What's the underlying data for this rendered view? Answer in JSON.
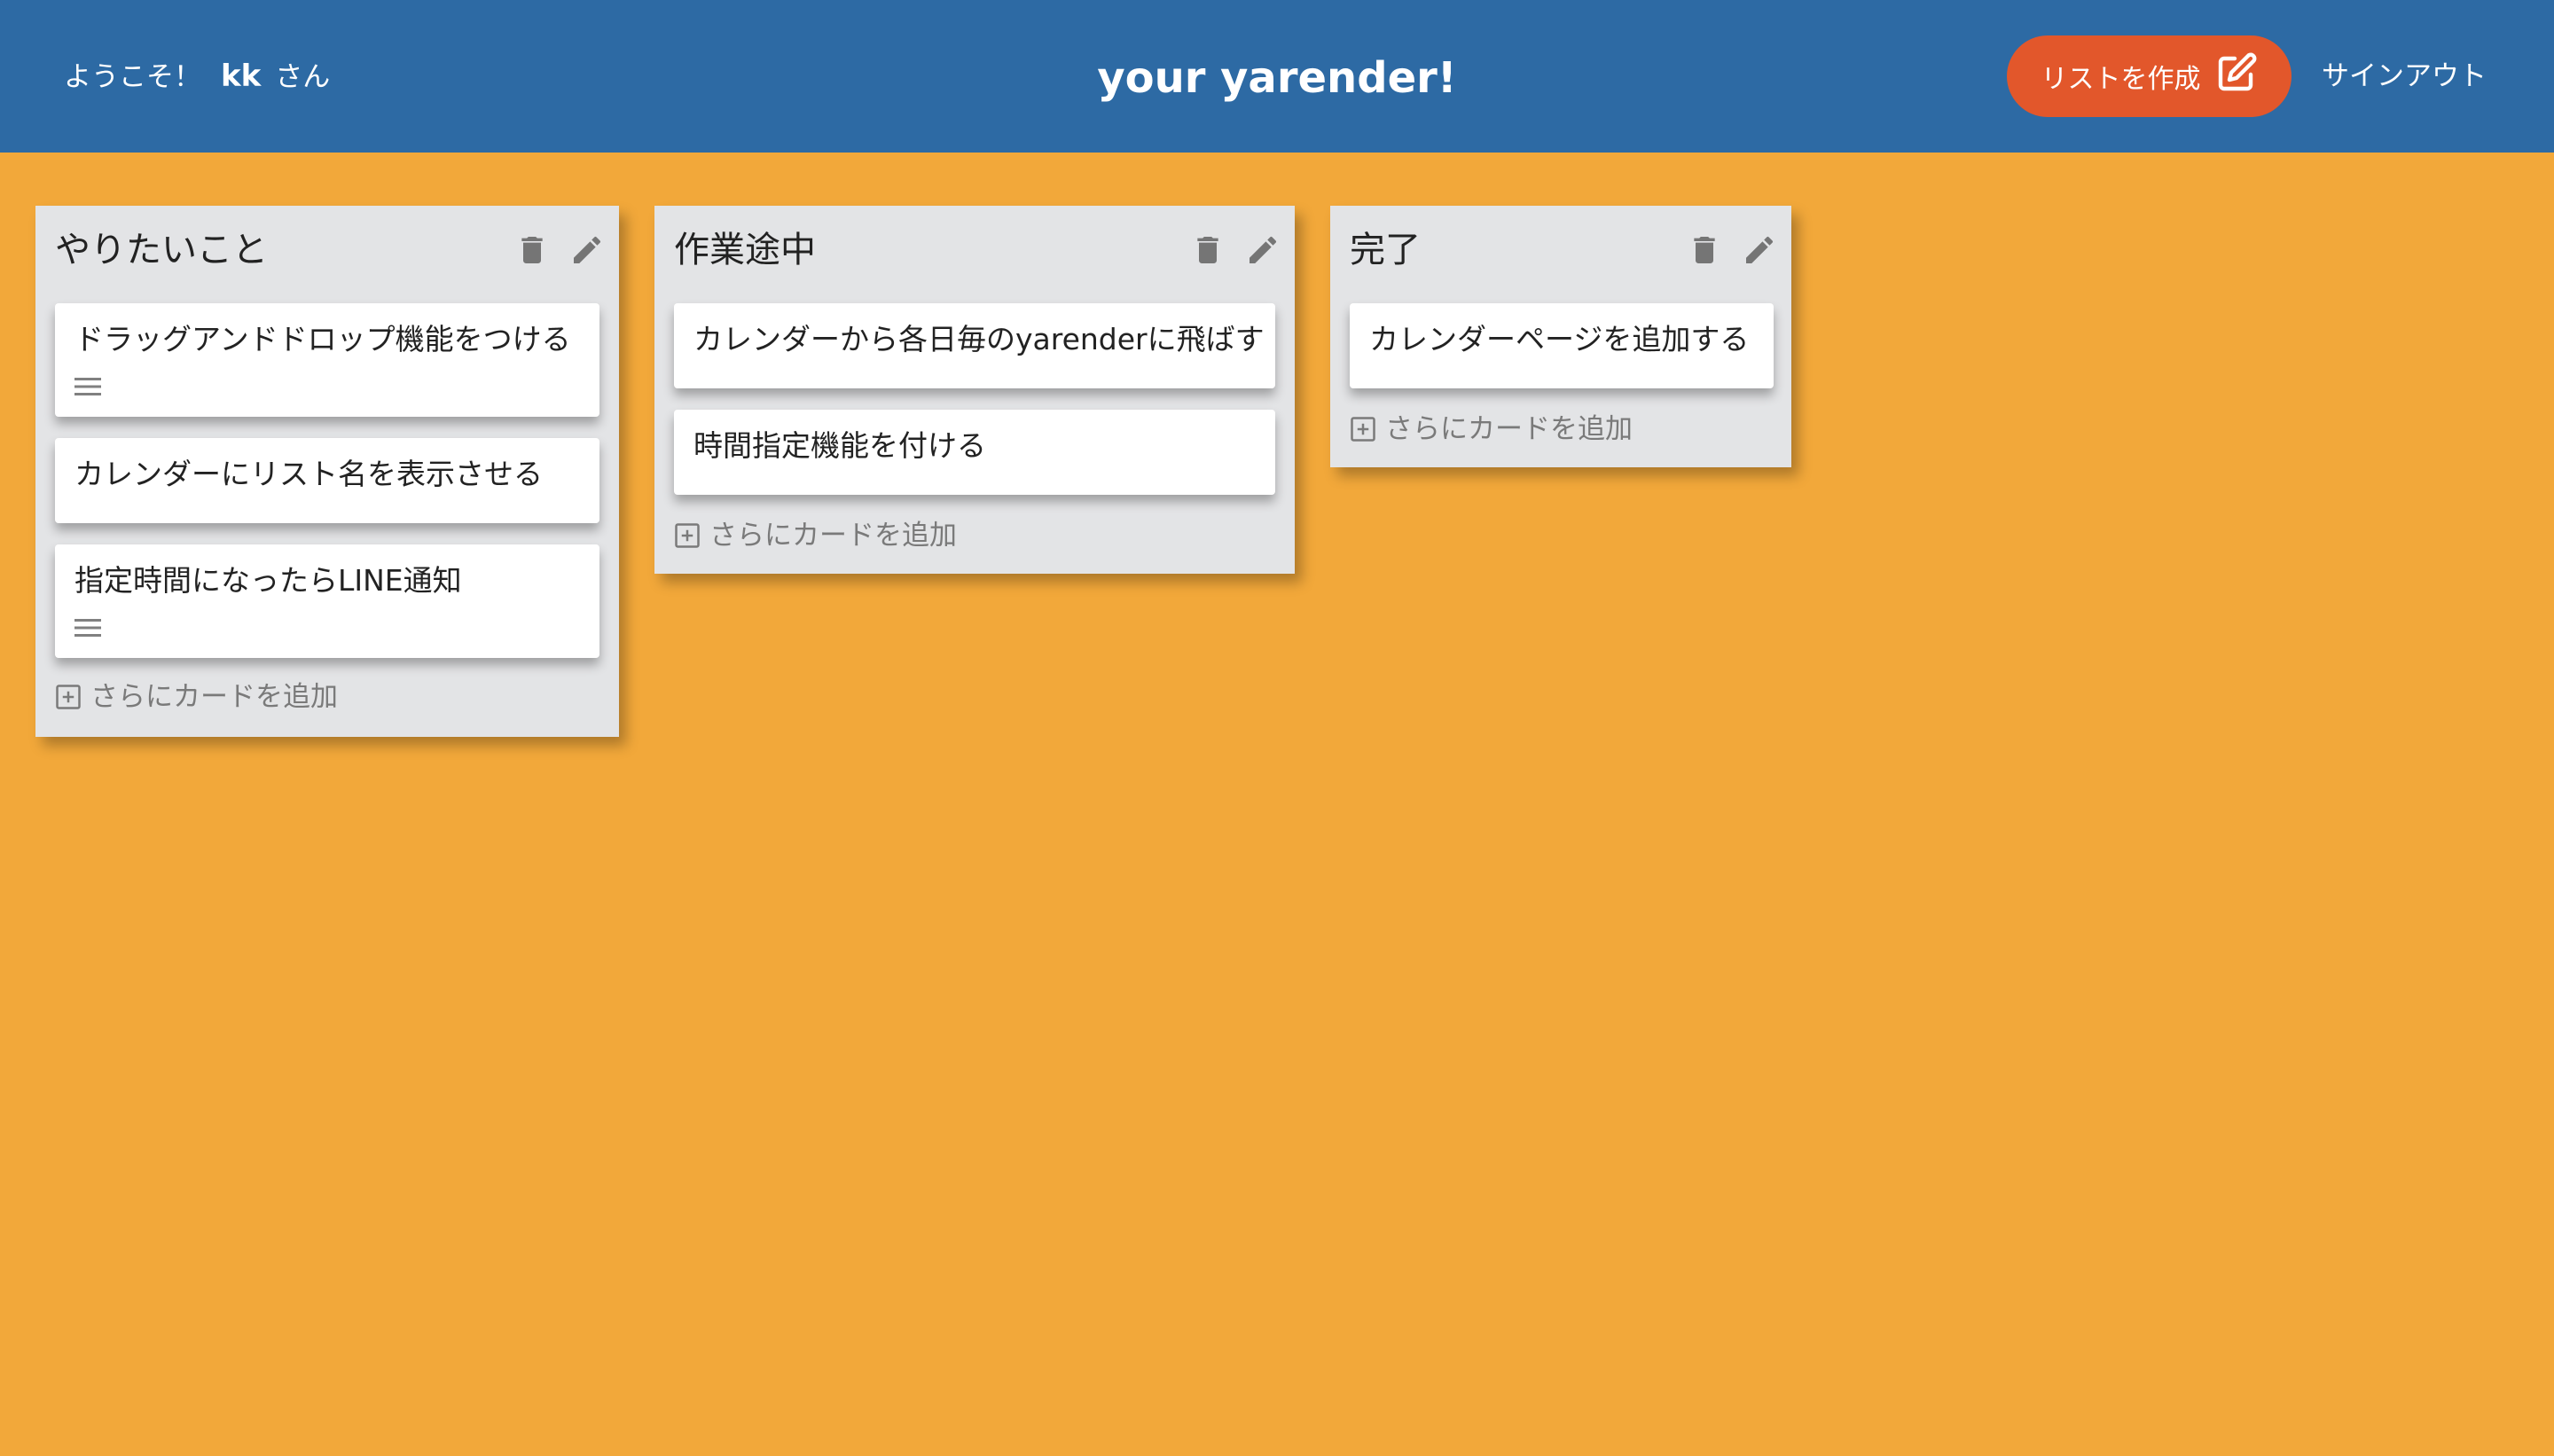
{
  "header": {
    "welcome_prefix": "ようこそ！",
    "username": "kk",
    "welcome_suffix": "さん",
    "title": "your yarender!",
    "create_list_label": "リストを作成",
    "create_list_icon": "edit-icon",
    "signout_label": "サインアウト"
  },
  "colors": {
    "header_bg": "#2d6aa4",
    "page_bg": "#f2a83a",
    "accent_button": "#e2572b",
    "list_bg": "#e3e4e6"
  },
  "icons": {
    "delete": "trash-icon",
    "edit": "pencil-icon",
    "description": "menu-lines-icon",
    "add": "plus-square-icon"
  },
  "add_card_label": "さらにカードを追加",
  "lists": [
    {
      "title": "やりたいこと",
      "cards": [
        {
          "text": "ドラッグアンドドロップ機能をつける",
          "has_description": true
        },
        {
          "text": "カレンダーにリスト名を表示させる",
          "has_description": false
        },
        {
          "text": "指定時間になったらLINE通知",
          "has_description": true
        }
      ]
    },
    {
      "title": "作業途中",
      "cards": [
        {
          "text": "カレンダーから各日毎のyarenderに飛ばす",
          "has_description": false
        },
        {
          "text": "時間指定機能を付ける",
          "has_description": false
        }
      ]
    },
    {
      "title": "完了",
      "cards": [
        {
          "text": "カレンダーページを追加する",
          "has_description": false
        }
      ]
    }
  ]
}
